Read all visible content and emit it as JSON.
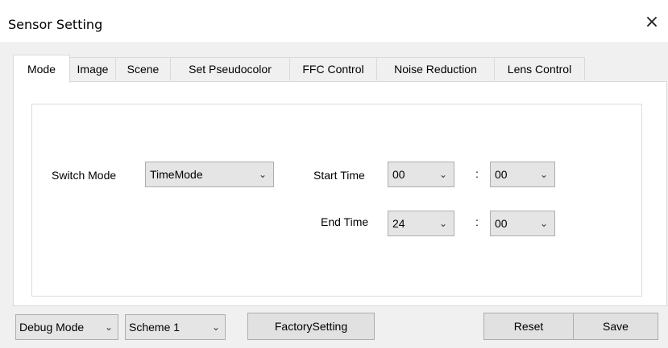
{
  "window": {
    "title": "Sensor Setting",
    "close_icon": "×"
  },
  "tabs": [
    {
      "label": "Mode",
      "active": true
    },
    {
      "label": "Image"
    },
    {
      "label": "Scene"
    },
    {
      "label": "Set Pseudocolor"
    },
    {
      "label": "FFC Control"
    },
    {
      "label": "Noise Reduction"
    },
    {
      "label": "Lens Control"
    }
  ],
  "mode_panel": {
    "switch_mode": {
      "label": "Switch Mode",
      "value": "TimeMode"
    },
    "start_time": {
      "label": "Start Time",
      "hour": "00",
      "minute": "00"
    },
    "end_time": {
      "label": "End Time",
      "hour": "24",
      "minute": "00"
    },
    "separator": ":"
  },
  "footer": {
    "debug_mode": "Debug Mode",
    "scheme": "Scheme 1",
    "factory_setting": "FactorySetting",
    "reset": "Reset",
    "save": "Save"
  },
  "icons": {
    "chevron": "chevron-down-icon",
    "close": "close-icon"
  },
  "colors": {
    "window_bg": "#f0f0f0",
    "button_bg": "#e1e1e1",
    "border": "#adadad"
  }
}
